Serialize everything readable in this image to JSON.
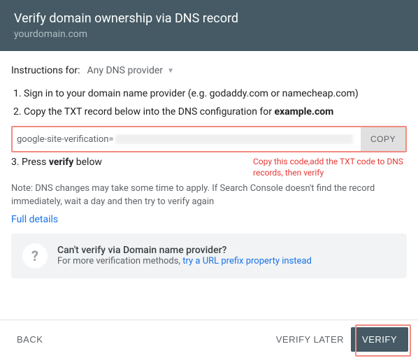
{
  "header": {
    "title": "Verify domain ownership via DNS record",
    "subtitle": "yourdomain.com"
  },
  "instructions_label": "Instructions for:",
  "provider_dropdown": "Any DNS provider",
  "steps": {
    "s1": "Sign in to your domain name provider (e.g. godaddy.com or namecheap.com)",
    "s2_prefix": "Copy the TXT record below into the DNS configuration for ",
    "s2_domain": "example.com",
    "s3_prefix": "3. Press ",
    "s3_bold": "verify",
    "s3_suffix": " below"
  },
  "txt_record_prefix": "google-site-verification=",
  "copy_button": "COPY",
  "annotation": "Copy this code,add the TXT code to DNS records, then verify",
  "note": "Note: DNS changes may take some time to apply. If Search Console doesn't find the record immediately, wait a day and then try to verify again",
  "full_details": "Full details",
  "alt": {
    "title": "Can't verify via Domain name provider?",
    "sub_prefix": "For more verification methods, ",
    "sub_link": "try a URL prefix property instead"
  },
  "footer": {
    "back": "BACK",
    "verify_later": "VERIFY LATER",
    "verify": "VERIFY"
  }
}
